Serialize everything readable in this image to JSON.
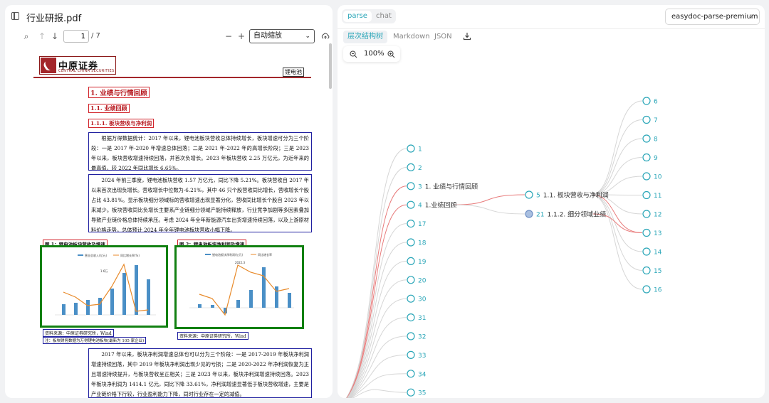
{
  "left": {
    "file_title": "行业研报.pdf",
    "page_current": "1",
    "page_total": "/ 7",
    "zoom_label": "自动缩放"
  },
  "doc": {
    "logo_text": "中原证券",
    "logo_sub": "CENTRAL CHINA SECURITIES",
    "tag": "锂电池",
    "h1": "1. 业绩与行情回顾",
    "h2": "1.1. 业绩回顾",
    "h3": "1.1.1. 板块营收与净利润",
    "p1": "根据万得数据统计：2017 年以来，锂电池板块营收总体持续增长，板块增速可分为三个阶段：一是 2017 年-2020 年增速总体回落；二是 2021 年-2022 年的高增长阶段；三是 2023 年以来，板块营收增速持续回落，并首次负增长。2023 年板块营收 2.25 万亿元，为近年来的最高值，较 2022 年同比增长 6.65%。",
    "p2": "2024 年前三季度，锂电池板块营收 1.57 万亿元，同比下降 5.21%。板块营收自 2017 年以来首次出现负增长。营收增长中位数为-6.21%，其中 46 只个股营收同比增长，营收增长个股占比 43.81%。显示板块细分领域标的营收增速出现显著分化，营收同比增长个股自 2023 年以来减少。板块营收同比负增长主要系产业链细分领域产能持续释放，行业竞争加剧等多因素叠加导致产业链价格总体持续承压。考虑 2024 年全年新能源汽车出货增速持续回落，以及上游原材料价格走势，总体预计 2024 年全年锂电池板块营收小幅下降。",
    "cap1": "图 1：锂电池板块营收及增速",
    "cap2": "图 2：锂电池板块净利润及增速",
    "src1": "资料来源：中原证券研究所，Wind",
    "note1": "注：板块财务数据为万得锂电池板块(最新为 105 家企业)",
    "src2": "资料来源：中原证券研究所，Wind",
    "p3": "2017 年以来，板块净利润增速总体也可以分为三个阶段：一是 2017-2019 年板块净利润增速持续回落，其中 2019 年板块净利润出现少见的亏损；二是 2020-2022 年净利润恢复为正且增速持续提升，与板块营收呈正相关；三是 2023 年以来，板块净利润增速持续回落。2023 年板块净利润为 1414.1 亿元，同比下降 33.61%，净利润增速显著低于板块营收增速，主要是产业链价格下行较，行业盈利能力下降，同时行业存在一定的减值。"
  },
  "charts": {
    "chart1": {
      "legend": [
        "营业总收入(亿元)",
        "同比增长率(%)"
      ],
      "label": "1.6万"
    },
    "chart2": {
      "legend": [
        "锂电池板块净利润(亿元)",
        "同比增长率"
      ],
      "label": "2022.3"
    }
  },
  "right": {
    "mode_tabs": [
      "parse",
      "chat"
    ],
    "active_mode": "parse",
    "model": "easydoc-parse-premium",
    "view_tabs": [
      "层次结构树",
      "Markdown",
      "JSON"
    ],
    "active_view": "层次结构树",
    "zoom": "100%"
  },
  "tree": {
    "root": {
      "id": "4",
      "label": "1.业绩回顾"
    },
    "left_nodes": [
      {
        "id": "1",
        "label": ""
      },
      {
        "id": "2",
        "label": ""
      },
      {
        "id": "3",
        "label": "1. 业绩与行情回顾"
      },
      {
        "id": "4",
        "label": "1.业绩回顾"
      },
      {
        "id": "17",
        "label": ""
      },
      {
        "id": "18",
        "label": ""
      },
      {
        "id": "19",
        "label": ""
      },
      {
        "id": "20",
        "label": ""
      },
      {
        "id": "30",
        "label": ""
      },
      {
        "id": "31",
        "label": ""
      },
      {
        "id": "32",
        "label": ""
      },
      {
        "id": "33",
        "label": ""
      },
      {
        "id": "34",
        "label": ""
      },
      {
        "id": "35",
        "label": ""
      }
    ],
    "mid_nodes": [
      {
        "id": "5",
        "label": "1.1. 板块营收与净利润"
      },
      {
        "id": "21",
        "label": "1.1.2. 细分领域业绩"
      }
    ],
    "right_nodes": [
      "6",
      "7",
      "8",
      "9",
      "10",
      "11",
      "12",
      "13",
      "14",
      "15",
      "16"
    ],
    "accent": "#2aa6b8",
    "highlight": "#e87c7c"
  }
}
